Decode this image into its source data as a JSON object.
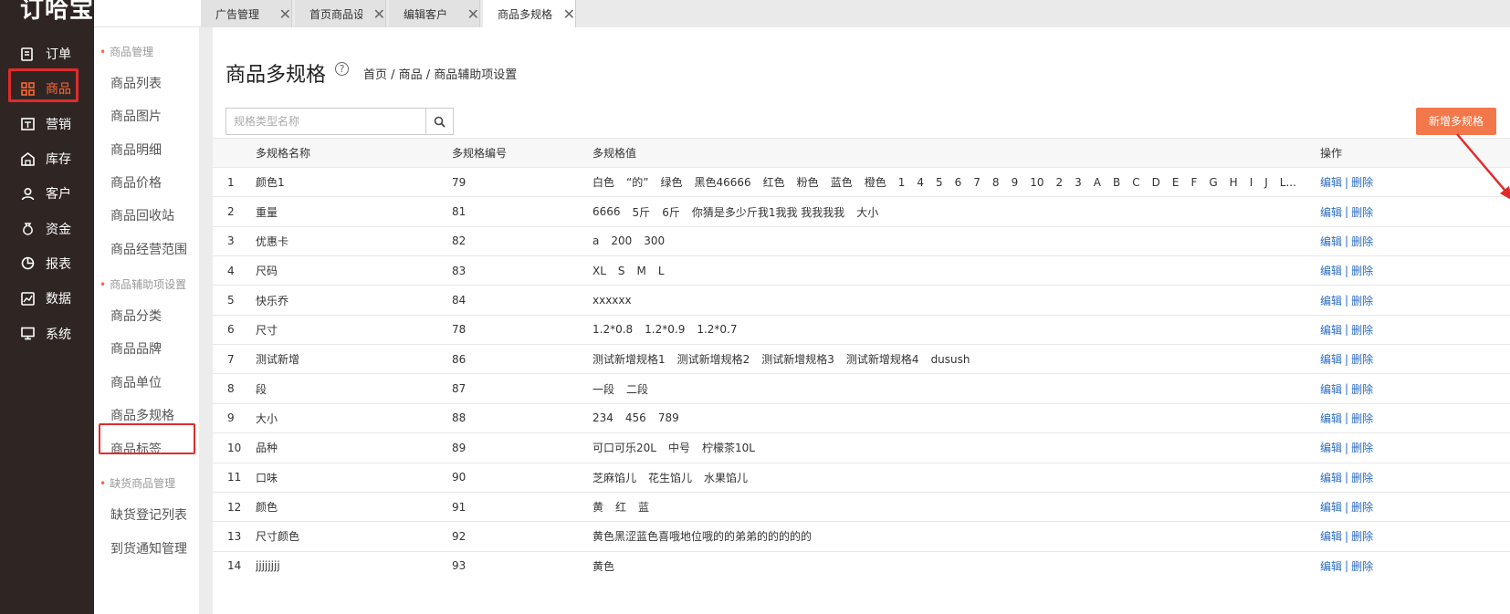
{
  "app": {
    "logo": "订哈宝"
  },
  "nav": [
    {
      "label": "订单",
      "icon": "order-icon"
    },
    {
      "label": "商品",
      "icon": "grid-icon",
      "active": true
    },
    {
      "label": "营销",
      "icon": "marketing-icon"
    },
    {
      "label": "库存",
      "icon": "warehouse-icon"
    },
    {
      "label": "客户",
      "icon": "user-icon"
    },
    {
      "label": "资金",
      "icon": "money-bag-icon"
    },
    {
      "label": "报表",
      "icon": "pie-chart-icon"
    },
    {
      "label": "数据",
      "icon": "data-icon"
    },
    {
      "label": "系统",
      "icon": "monitor-icon"
    }
  ],
  "submenu": {
    "group1": "商品管理",
    "group2": "商品辅助项设置",
    "group3": "缺货商品管理",
    "items": [
      "商品列表",
      "商品图片",
      "商品明细",
      "商品价格",
      "商品回收站",
      "商品经营范围",
      "商品分类",
      "商品品牌",
      "商品单位",
      "商品多规格",
      "商品标签",
      "缺货登记列表",
      "到货通知管理"
    ]
  },
  "tabs": [
    {
      "label": "广告管理"
    },
    {
      "label": "首页商品设置"
    },
    {
      "label": "编辑客户"
    },
    {
      "label": "商品多规格",
      "active": true
    }
  ],
  "page": {
    "title": "商品多规格",
    "help": "?",
    "breadcrumb": "首页 / 商品 / 商品辅助项设置",
    "search_placeholder": "规格类型名称",
    "add_button": "新增多规格"
  },
  "table": {
    "headers": [
      "多规格名称",
      "多规格编号",
      "多规格值",
      "操作"
    ],
    "edit_label": "编辑",
    "sep": "|",
    "delete_label": "删除",
    "rows": [
      {
        "idx": "1",
        "name": "颜色1",
        "code": "79",
        "values": [
          "白色",
          "“的”",
          "绿色",
          "黑色46666",
          "红色",
          "粉色",
          "蓝色",
          "橙色",
          "1",
          "4",
          "5",
          "6",
          "7",
          "8",
          "9",
          "10",
          "2",
          "3",
          "A",
          "B",
          "C",
          "D",
          "E",
          "F",
          "G",
          "H",
          "I",
          "J",
          "L..."
        ]
      },
      {
        "idx": "2",
        "name": "重量",
        "code": "81",
        "values": [
          "6666",
          "5斤",
          "6斤",
          "你猜是多少斤我1我我 我我我我",
          "大小"
        ]
      },
      {
        "idx": "3",
        "name": "优惠卡",
        "code": "82",
        "values": [
          "a",
          "200",
          "300"
        ]
      },
      {
        "idx": "4",
        "name": "尺码",
        "code": "83",
        "values": [
          "XL",
          "S",
          "M",
          "L"
        ]
      },
      {
        "idx": "5",
        "name": "快乐乔",
        "code": "84",
        "values": [
          "xxxxxx"
        ]
      },
      {
        "idx": "6",
        "name": "尺寸",
        "code": "78",
        "values": [
          "1.2*0.8",
          "1.2*0.9",
          "1.2*0.7"
        ]
      },
      {
        "idx": "7",
        "name": "测试新增",
        "code": "86",
        "values": [
          "测试新增规格1",
          "测试新增规格2",
          "测试新增规格3",
          "测试新增规格4",
          "dusush"
        ]
      },
      {
        "idx": "8",
        "name": "段",
        "code": "87",
        "values": [
          "一段",
          "二段"
        ]
      },
      {
        "idx": "9",
        "name": "大小",
        "code": "88",
        "values": [
          "234",
          "456",
          "789"
        ]
      },
      {
        "idx": "10",
        "name": "品种",
        "code": "89",
        "values": [
          "可口可乐20L",
          "中号",
          "柠檬茶10L"
        ]
      },
      {
        "idx": "11",
        "name": "口味",
        "code": "90",
        "values": [
          "芝麻馅儿",
          "花生馅儿",
          "水果馅儿"
        ]
      },
      {
        "idx": "12",
        "name": "颜色",
        "code": "91",
        "values": [
          "黄",
          "红",
          "蓝"
        ]
      },
      {
        "idx": "13",
        "name": "尺寸颜色",
        "code": "92",
        "values": [
          "黄色黑涩蓝色喜哦地位哦的的弟弟的的的的的"
        ]
      },
      {
        "idx": "14",
        "name": "jjjjjjjj",
        "code": "93",
        "values": [
          "黄色"
        ]
      }
    ]
  },
  "colors": {
    "accent": "#f2784b",
    "highlight_box": "#e02b2b",
    "sidebar_bg": "#2f2624",
    "link": "#2b6cc4"
  }
}
